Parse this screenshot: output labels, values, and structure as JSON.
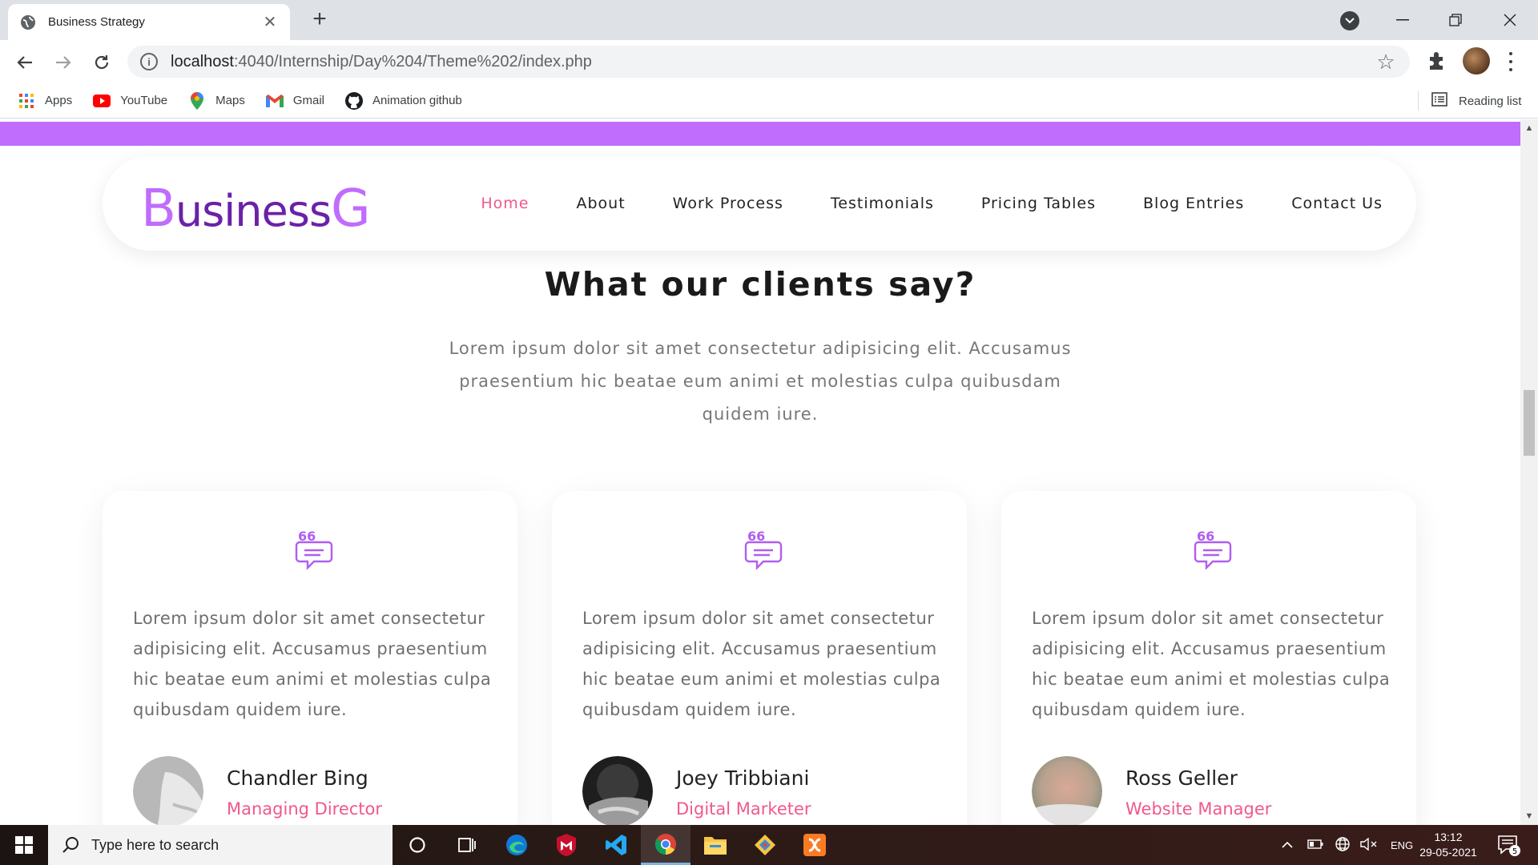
{
  "browser": {
    "tab_title": "Business Strategy",
    "new_tab_symbol": "+",
    "url_host": "localhost",
    "url_path": ":4040/Internship/Day%204/Theme%202/index.php",
    "bookmarks": [
      {
        "label": "Apps",
        "icon": "apps-grid-icon"
      },
      {
        "label": "YouTube",
        "icon": "youtube-icon"
      },
      {
        "label": "Maps",
        "icon": "maps-pin-icon"
      },
      {
        "label": "Gmail",
        "icon": "gmail-icon"
      },
      {
        "label": "Animation github",
        "icon": "github-icon"
      }
    ],
    "reading_list": "Reading list"
  },
  "site": {
    "logo_first": "B",
    "logo_middle": "usiness",
    "logo_last": "G",
    "nav": [
      {
        "label": "Home",
        "active": true
      },
      {
        "label": "About"
      },
      {
        "label": "Work Process"
      },
      {
        "label": "Testimonials"
      },
      {
        "label": "Pricing Tables"
      },
      {
        "label": "Blog Entries"
      },
      {
        "label": "Contact Us"
      }
    ],
    "accent_color": "#c06cfc",
    "highlight_color": "#f0588e"
  },
  "testimonials": {
    "title": "What our clients say?",
    "description": "Lorem ipsum dolor sit amet consectetur adipisicing elit. Accusamus praesentium hic beatae eum animi et molestias culpa quibusdam quidem iure.",
    "cards": [
      {
        "quote": "Lorem ipsum dolor sit amet consectetur adipisicing elit. Accusamus praesentium hic beatae eum animi et molestias culpa quibusdam quidem iure.",
        "name": "Chandler Bing",
        "role": "Managing Director"
      },
      {
        "quote": "Lorem ipsum dolor sit amet consectetur adipisicing elit. Accusamus praesentium hic beatae eum animi et molestias culpa quibusdam quidem iure.",
        "name": "Joey Tribbiani",
        "role": "Digital Marketer"
      },
      {
        "quote": "Lorem ipsum dolor sit amet consectetur adipisicing elit. Accusamus praesentium hic beatae eum animi et molestias culpa quibusdam quidem iure.",
        "name": "Ross Geller",
        "role": "Website Manager"
      }
    ]
  },
  "taskbar": {
    "search_placeholder": "Type here to search",
    "language": "ENG",
    "time": "13:12",
    "date": "29-05-2021",
    "notifications": "5"
  }
}
